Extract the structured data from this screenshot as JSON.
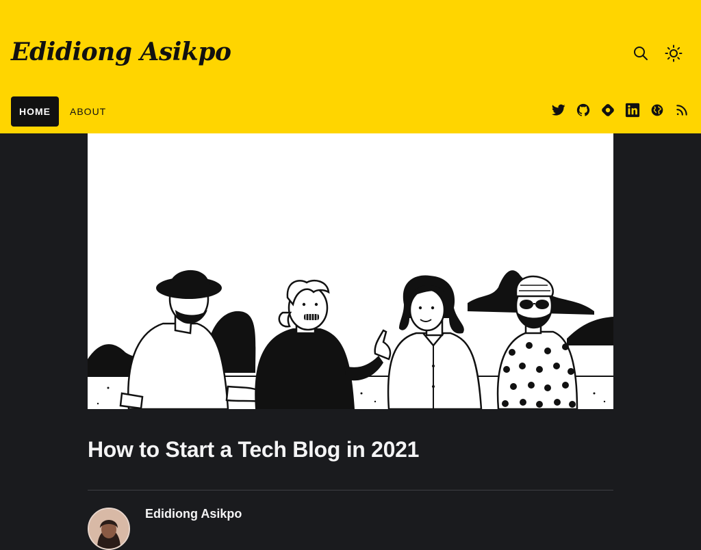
{
  "site": {
    "title": "Edidiong Asikpo"
  },
  "header_icons": {
    "search": "search-icon",
    "theme": "sun-icon"
  },
  "nav": {
    "items": [
      {
        "label": "HOME",
        "active": true
      },
      {
        "label": "ABOUT",
        "active": false
      }
    ]
  },
  "social": [
    "twitter-icon",
    "github-icon",
    "hashnode-icon",
    "linkedin-icon",
    "globe-icon",
    "rss-icon"
  ],
  "post": {
    "title": "How to Start a Tech Blog in 2021",
    "author": "Edidiong Asikpo"
  },
  "colors": {
    "header_bg": "#ffd500",
    "page_bg": "#1a1b1e",
    "text_light": "#f4f4f5",
    "nav_active_bg": "#111111"
  }
}
